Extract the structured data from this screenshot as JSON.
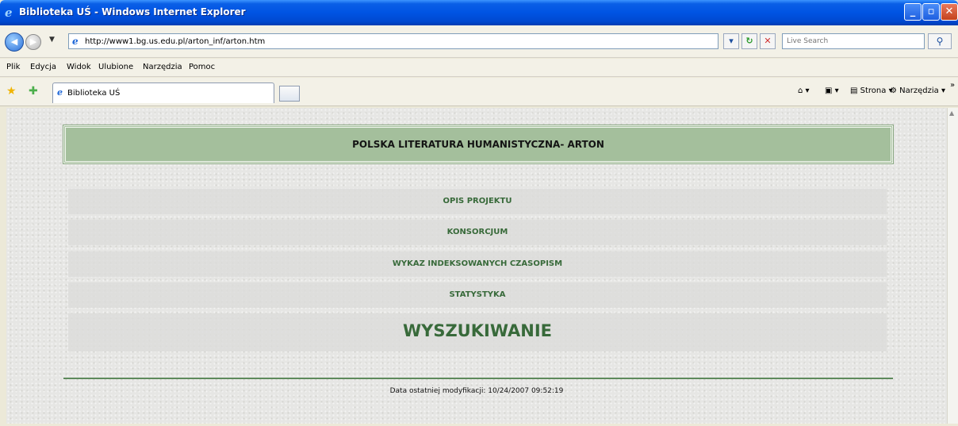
{
  "window": {
    "title": "Biblioteka UŚ - Windows Internet Explorer",
    "app_icon": "ie-logo-icon",
    "controls": [
      "minimize-icon",
      "maximize-icon",
      "close-icon"
    ]
  },
  "address_bar": {
    "url": "http://www1.bg.us.edu.pl/arton_inf/arton.htm",
    "search_placeholder": "Live Search"
  },
  "menu": [
    "Plik",
    "Edycja",
    "Widok",
    "Ulubione",
    "Narzędzia",
    "Pomoc"
  ],
  "tab": {
    "label": "Biblioteka UŚ"
  },
  "toolbar_right": {
    "page_label": "Strona",
    "tools_label": "Narzędzia",
    "more": "»"
  },
  "page": {
    "header_title": "POLSKA LITERATURA HUMANISTYCZNA- ARTON",
    "links": [
      "OPIS PROJEKTU",
      "KONSORCJUM",
      "WYKAZ INDEKSOWANYCH CZASOPISM",
      "STATYSTYKA",
      "WYSZUKIWANIE"
    ],
    "footer": "Data ostatniej modyfikacji: 10/24/2007 09:52:19"
  },
  "colors": {
    "titlebar": "#0054e3",
    "header_band": "#a4bf9c",
    "link_text": "#386a3a",
    "divider": "#5e8a5c"
  }
}
